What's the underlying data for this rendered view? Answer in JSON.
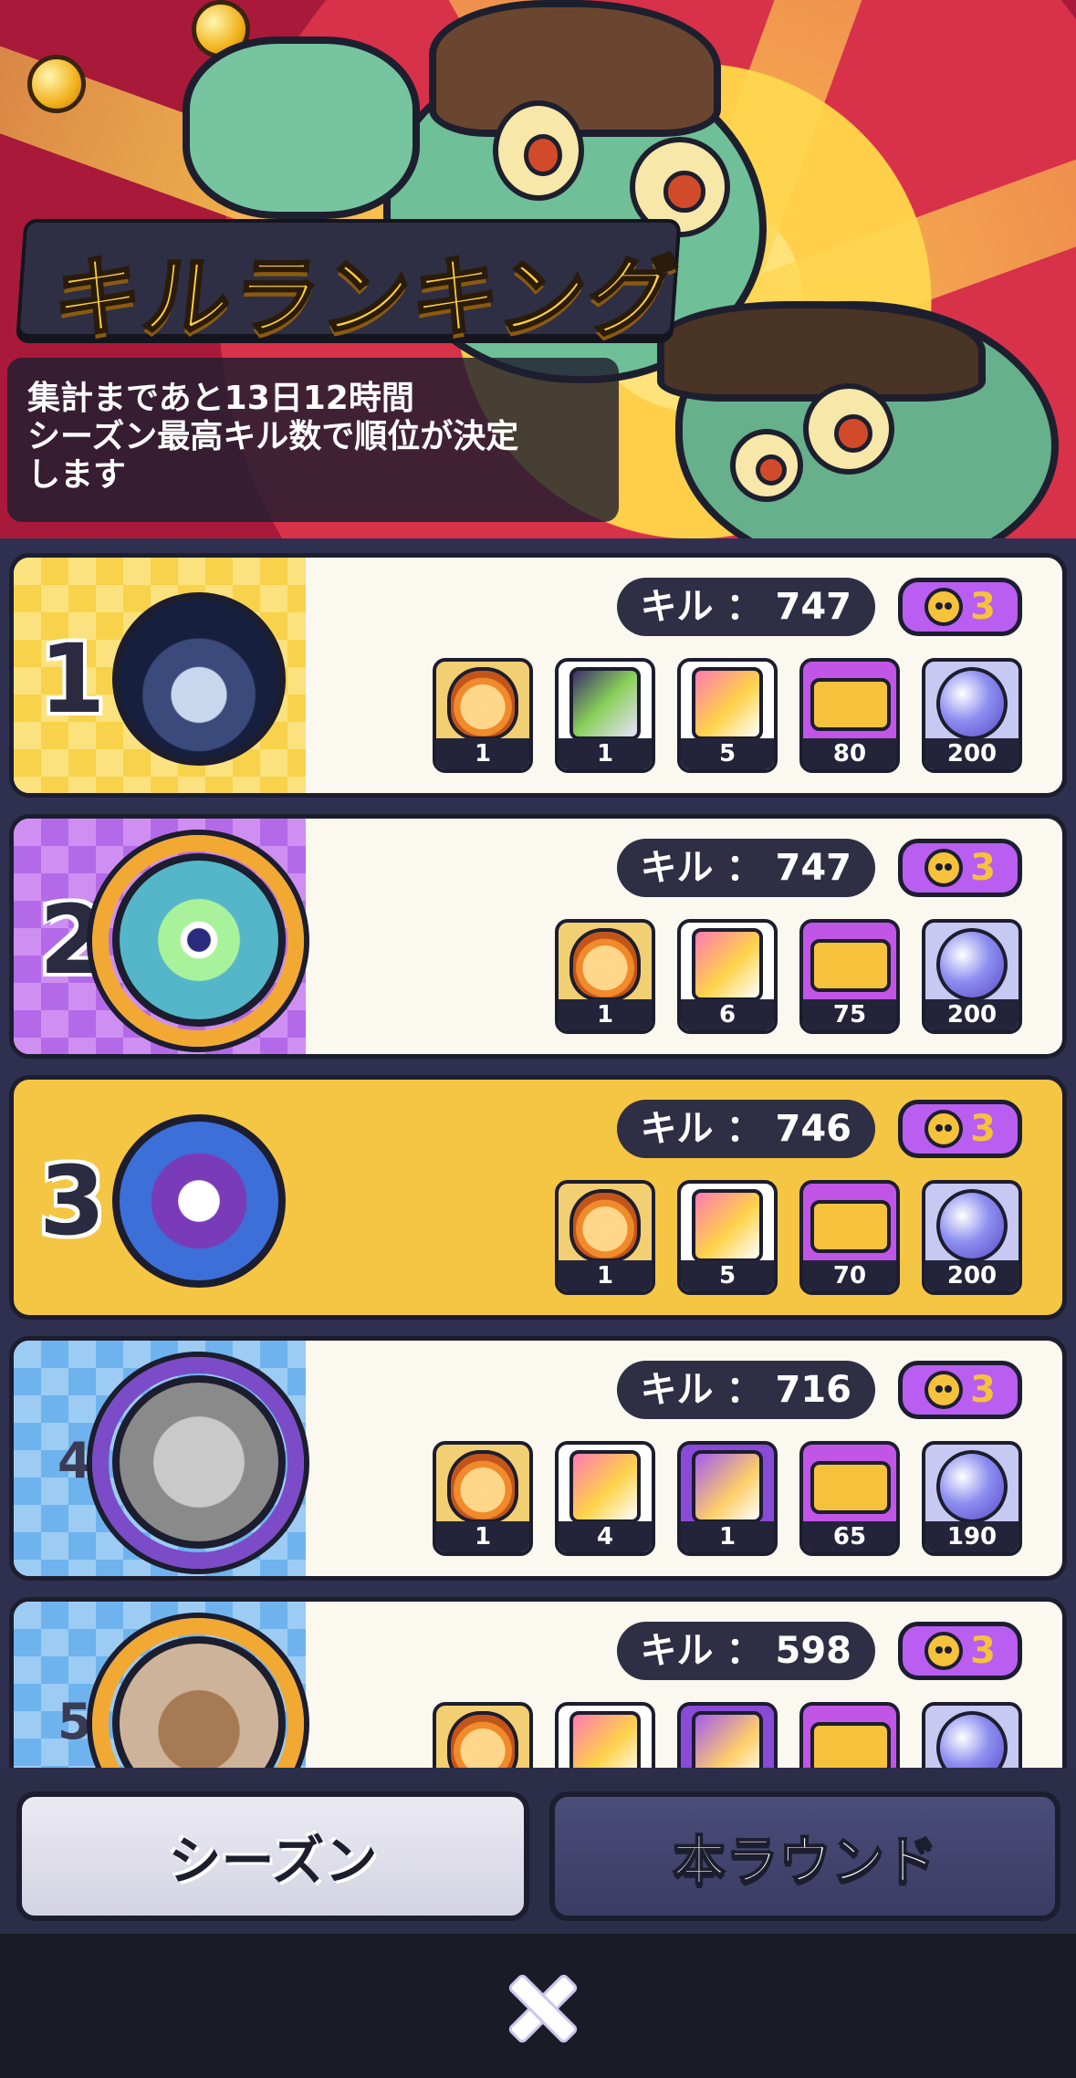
{
  "header": {
    "title": "キルランキング",
    "info_lines": [
      "集計まであと13日12時間",
      "シーズン最高キル数で順位が決定",
      "します"
    ]
  },
  "rankings": [
    {
      "rank": "1",
      "kill_label": "キル",
      "kills": "747",
      "badge": "3",
      "rewards": [
        {
          "type": "frame",
          "count": "1"
        },
        {
          "type": "card-dark",
          "count": "1"
        },
        {
          "type": "card",
          "count": "5"
        },
        {
          "type": "ticket",
          "count": "80"
        },
        {
          "type": "orb",
          "count": "200"
        }
      ]
    },
    {
      "rank": "2",
      "kill_label": "キル",
      "kills": "747",
      "badge": "3",
      "rewards": [
        {
          "type": "frame",
          "count": "1"
        },
        {
          "type": "card",
          "count": "6"
        },
        {
          "type": "ticket",
          "count": "75"
        },
        {
          "type": "orb",
          "count": "200"
        }
      ]
    },
    {
      "rank": "3",
      "kill_label": "キル",
      "kills": "746",
      "badge": "3",
      "rewards": [
        {
          "type": "frame",
          "count": "1"
        },
        {
          "type": "card",
          "count": "5"
        },
        {
          "type": "ticket",
          "count": "70"
        },
        {
          "type": "orb",
          "count": "200"
        }
      ]
    },
    {
      "rank": "4",
      "kill_label": "キル",
      "kills": "716",
      "badge": "3",
      "rewards": [
        {
          "type": "frame",
          "count": "1"
        },
        {
          "type": "card",
          "count": "4"
        },
        {
          "type": "card-purple",
          "count": "1"
        },
        {
          "type": "ticket",
          "count": "65"
        },
        {
          "type": "orb",
          "count": "190"
        }
      ]
    },
    {
      "rank": "5",
      "kill_label": "キル",
      "kills": "598",
      "badge": "3",
      "rewards": [
        {
          "type": "frame",
          "count": ""
        },
        {
          "type": "card",
          "count": ""
        },
        {
          "type": "card-purple",
          "count": ""
        },
        {
          "type": "ticket",
          "count": ""
        },
        {
          "type": "orb",
          "count": ""
        }
      ]
    }
  ],
  "tabs": {
    "season": "シーズン",
    "round": "本ラウンド",
    "active": "season"
  },
  "colors": {
    "accent_gold": "#f5c544",
    "purple": "#b95ef0",
    "panel_dark": "#2e2f44"
  },
  "icons": {
    "close": "close-icon",
    "badge": "skull-coin-icon"
  }
}
